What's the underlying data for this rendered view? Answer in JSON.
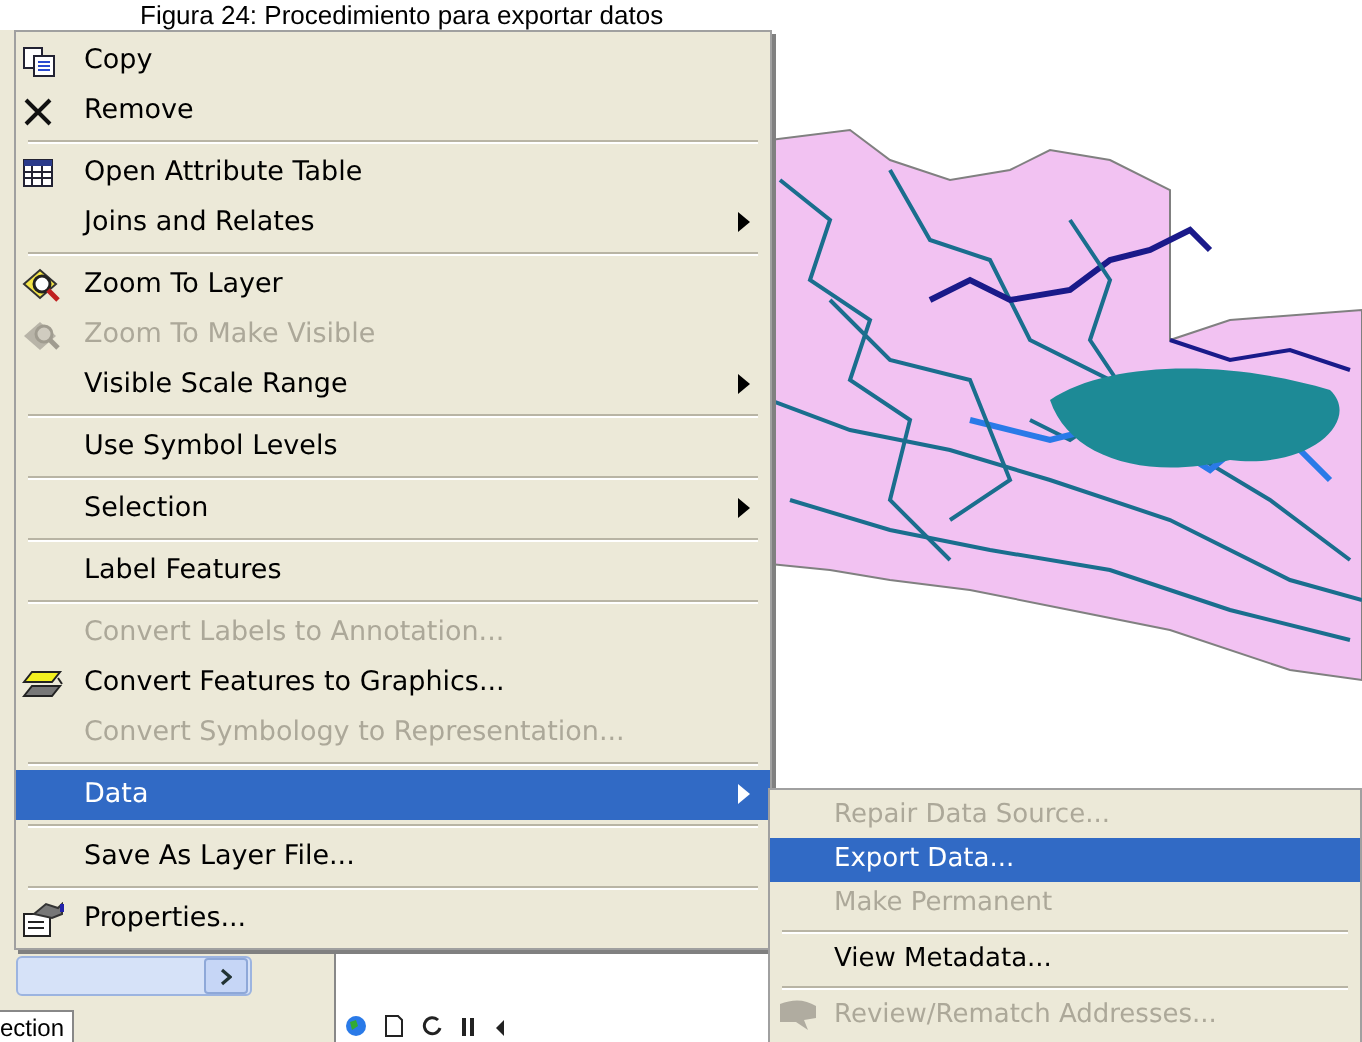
{
  "caption": "Figura 24: Procedimiento para exportar datos",
  "context_menu": {
    "groups": [
      [
        {
          "label": "Copy",
          "disabled": false,
          "submenu": false,
          "selected": false
        },
        {
          "label": "Remove",
          "disabled": false,
          "submenu": false,
          "selected": false
        }
      ],
      [
        {
          "label": "Open Attribute Table",
          "disabled": false,
          "submenu": false,
          "selected": false
        },
        {
          "label": "Joins and Relates",
          "disabled": false,
          "submenu": true,
          "selected": false
        }
      ],
      [
        {
          "label": "Zoom To Layer",
          "disabled": false,
          "submenu": false,
          "selected": false
        },
        {
          "label": "Zoom To Make Visible",
          "disabled": true,
          "submenu": false,
          "selected": false
        },
        {
          "label": "Visible Scale Range",
          "disabled": false,
          "submenu": true,
          "selected": false
        }
      ],
      [
        {
          "label": "Use Symbol Levels",
          "disabled": false,
          "submenu": false,
          "selected": false
        }
      ],
      [
        {
          "label": "Selection",
          "disabled": false,
          "submenu": true,
          "selected": false
        }
      ],
      [
        {
          "label": "Label Features",
          "disabled": false,
          "submenu": false,
          "selected": false
        }
      ],
      [
        {
          "label": "Convert Labels to Annotation...",
          "disabled": true,
          "submenu": false,
          "selected": false
        },
        {
          "label": "Convert Features to Graphics...",
          "disabled": false,
          "submenu": false,
          "selected": false
        },
        {
          "label": "Convert Symbology to Representation...",
          "disabled": true,
          "submenu": false,
          "selected": false
        }
      ],
      [
        {
          "label": "Data",
          "disabled": false,
          "submenu": true,
          "selected": true
        }
      ],
      [
        {
          "label": "Save As Layer File...",
          "disabled": false,
          "submenu": false,
          "selected": false
        }
      ],
      [
        {
          "label": "Properties...",
          "disabled": false,
          "submenu": false,
          "selected": false
        }
      ]
    ]
  },
  "submenu": {
    "groups": [
      [
        {
          "label": "Repair Data Source...",
          "disabled": true,
          "selected": false
        },
        {
          "label": "Export Data...",
          "disabled": false,
          "selected": true
        },
        {
          "label": "Make Permanent",
          "disabled": true,
          "selected": false
        }
      ],
      [
        {
          "label": "View Metadata...",
          "disabled": false,
          "selected": false
        }
      ],
      [
        {
          "label": "Review/Rematch Addresses...",
          "disabled": true,
          "selected": false
        }
      ]
    ]
  },
  "layer_panel": {
    "tab": "ection"
  }
}
